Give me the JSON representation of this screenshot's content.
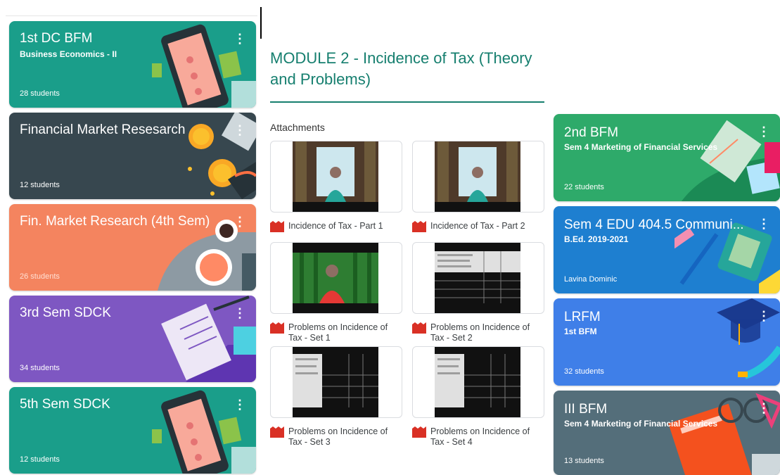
{
  "left_classes": [
    {
      "title": "1st DC BFM",
      "subtitle": "Business Economics - II",
      "students": "28 students",
      "color": "#1a9e8a"
    },
    {
      "title": "Financial Market Resesarch",
      "subtitle": "",
      "students": "12 students",
      "color": "#37474f"
    },
    {
      "title": "Fin. Market Research (4th Sem)",
      "subtitle": "",
      "students": "26 students",
      "color": "#f4845f"
    },
    {
      "title": "3rd Sem SDCK",
      "subtitle": "",
      "students": "34 students",
      "color": "#7e57c2"
    },
    {
      "title": "5th Sem SDCK",
      "subtitle": "",
      "students": "12 students",
      "color": "#1a9e8a"
    }
  ],
  "module": {
    "title": "MODULE 2 - Incidence of Tax (Theory and Problems)",
    "attachments_label": "Attachments",
    "attachments": [
      {
        "caption": "Incidence of Tax - Part 1",
        "thumb": "person-window"
      },
      {
        "caption": "Incidence of Tax - Part 2",
        "thumb": "person-window"
      },
      {
        "caption": "Problems on Incidence of Tax - Set 1",
        "thumb": "person-green"
      },
      {
        "caption": "Problems on Incidence of Tax - Set 2",
        "thumb": "spreadsheet"
      },
      {
        "caption": "Problems on Incidence of Tax - Set 3",
        "thumb": "spreadsheet"
      },
      {
        "caption": "Problems on Incidence of Tax - Set 4",
        "thumb": "spreadsheet"
      }
    ],
    "accent": "#167f6f"
  },
  "right_classes": [
    {
      "title": "2nd BFM",
      "subtitle": "Sem 4 Marketing of Financial Services",
      "students": "22 students",
      "color": "#2eaa6a"
    },
    {
      "title": "Sem 4  EDU 404.5 Communi...",
      "subtitle": "B.Ed. 2019-2021",
      "students": "Lavina Dominic",
      "color": "#1e7fd0"
    },
    {
      "title": "LRFM",
      "subtitle": "1st BFM",
      "students": "32 students",
      "color": "#3f7fe8"
    },
    {
      "title": "III BFM",
      "subtitle": "Sem 4  Marketing of Financial Services",
      "students": "13 students",
      "color": "#546e7a"
    }
  ],
  "more_icon": "⋮"
}
